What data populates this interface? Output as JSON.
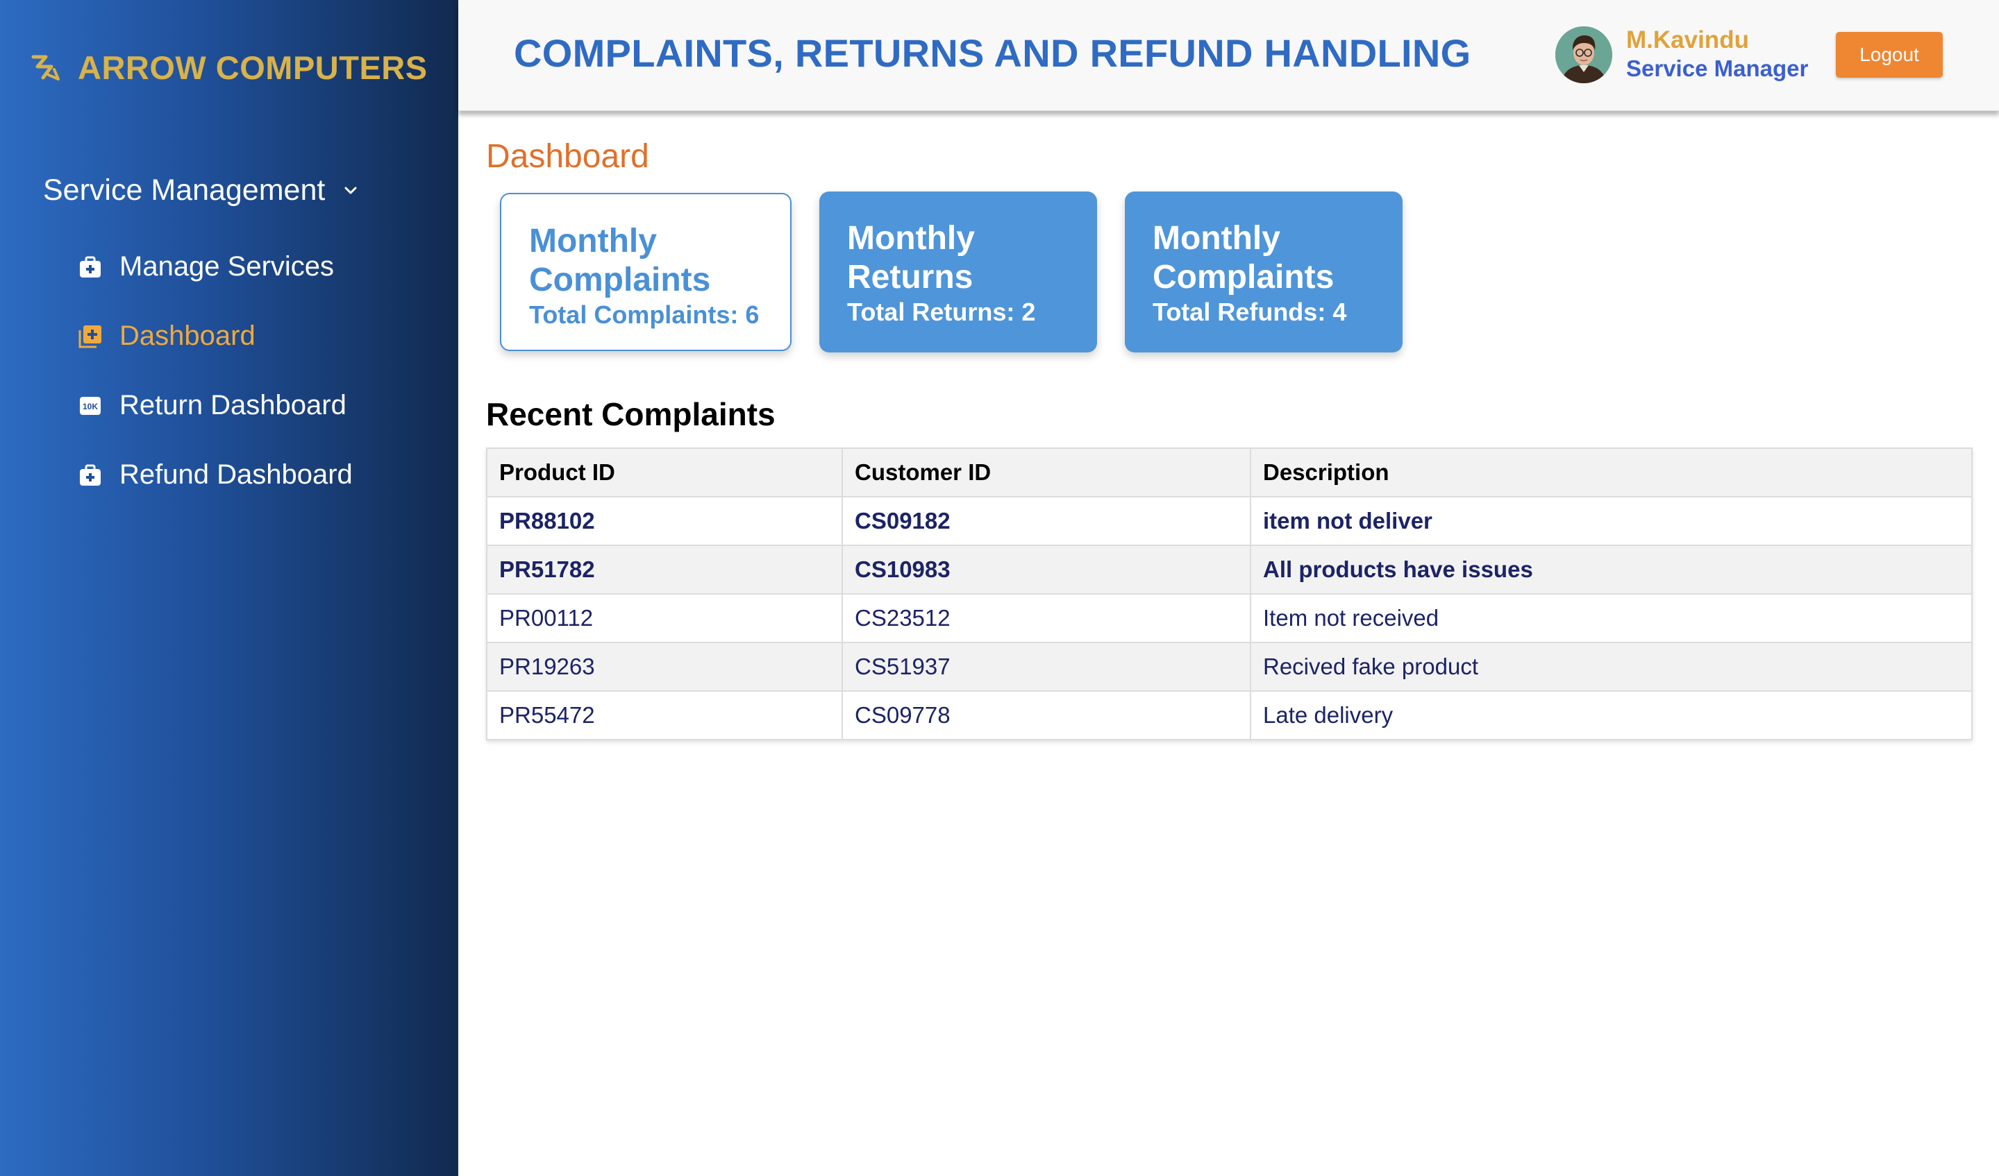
{
  "app": {
    "brand_name": "ARROW COMPUTERS",
    "brand_icon": "arrow-logo-icon",
    "accent_colors": {
      "brand_gold": "#d8b24a",
      "title_blue": "#2f6bc3",
      "active_orange": "#f0a93c",
      "logout_orange": "#ef8632",
      "card_blue": "#4f95d9"
    }
  },
  "header": {
    "title": "COMPLAINTS, RETURNS AND REFUND HANDLING",
    "user_name": "M.Kavindu",
    "user_role": "Service Manager",
    "logout_label": "Logout"
  },
  "sidebar": {
    "section_label": "Service Management",
    "items": [
      {
        "label": "Manage Services",
        "icon": "medical-bag-icon",
        "active": false
      },
      {
        "label": "Dashboard",
        "icon": "add-to-queue-icon",
        "active": true
      },
      {
        "label": "Return Dashboard",
        "icon": "10k-badge-icon",
        "active": false
      },
      {
        "label": "Refund Dashboard",
        "icon": "medical-bag-icon",
        "active": false
      }
    ]
  },
  "main": {
    "section_title": "Dashboard",
    "cards": [
      {
        "title": "Monthly Complaints",
        "value": "Total Complaints: 6"
      },
      {
        "title": "Monthly Returns",
        "value": "Total Returns: 2"
      },
      {
        "title": "Monthly Complaints",
        "value": "Total Refunds: 4"
      }
    ],
    "table_title": "Recent Complaints",
    "table": {
      "headers": [
        "Product ID",
        "Customer ID",
        "Description"
      ],
      "rows": [
        [
          "PR88102",
          "CS09182",
          "item not deliver"
        ],
        [
          "PR51782",
          "CS10983",
          "All products have issues"
        ],
        [
          "PR00112",
          "CS23512",
          "Item not received"
        ],
        [
          "PR19263",
          "CS51937",
          "Recived fake product"
        ],
        [
          "PR55472",
          "CS09778",
          "Late delivery"
        ]
      ]
    }
  }
}
